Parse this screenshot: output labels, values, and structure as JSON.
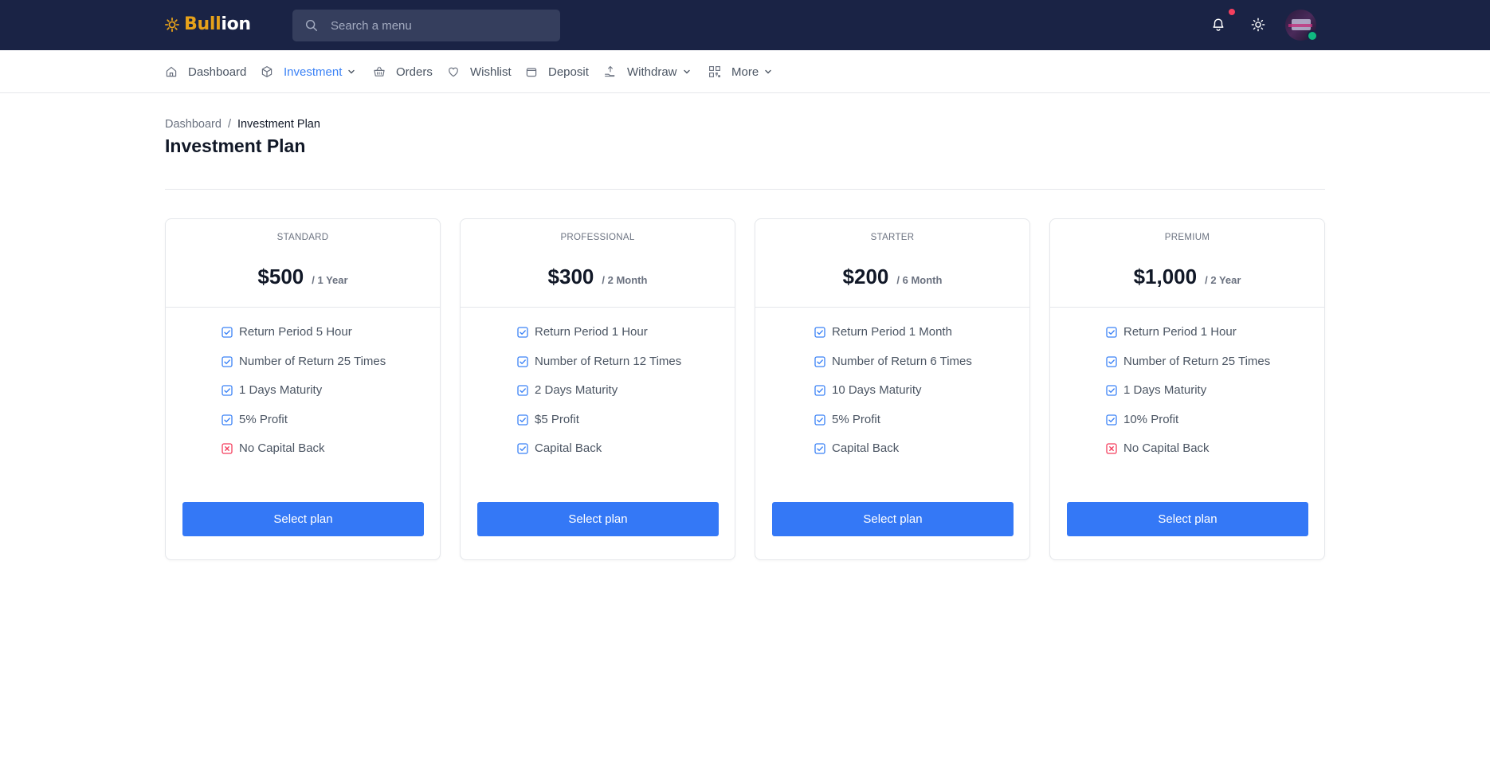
{
  "brand": {
    "part1": "Bull",
    "part2": "ion",
    "accent": "#e6a11a"
  },
  "search": {
    "placeholder": "Search a menu",
    "icon": "search-icon"
  },
  "topbar": {
    "bg": "#1a2345",
    "notification_icon": "bell-icon",
    "theme_icon": "sun-icon",
    "avatar": "user-avatar"
  },
  "nav": {
    "items": [
      {
        "label": "Dashboard",
        "icon": "home-icon"
      },
      {
        "label": "Investment",
        "icon": "cube-icon",
        "active": true,
        "dropdown": true
      },
      {
        "label": "Orders",
        "icon": "basket-icon"
      },
      {
        "label": "Wishlist",
        "icon": "heart-icon"
      },
      {
        "label": "Deposit",
        "icon": "wallet-icon"
      },
      {
        "label": "Withdraw",
        "icon": "withdraw-icon",
        "dropdown": true
      },
      {
        "label": "More",
        "icon": "qr-icon",
        "dropdown": true
      }
    ]
  },
  "breadcrumb": {
    "parent": "Dashboard",
    "separator": "/",
    "current": "Investment Plan"
  },
  "page": {
    "title": "Investment Plan"
  },
  "plans": [
    {
      "name": "STANDARD",
      "price": "$500",
      "period": "/ 1 Year",
      "features": [
        {
          "text": "Return Period 5 Hour",
          "ok": true
        },
        {
          "text": "Number of Return 25 Times",
          "ok": true
        },
        {
          "text": "1 Days Maturity",
          "ok": true
        },
        {
          "text": "5% Profit",
          "ok": true
        },
        {
          "text": "No Capital Back",
          "ok": false
        }
      ],
      "button": "Select plan"
    },
    {
      "name": "PROFESSIONAL",
      "price": "$300",
      "period": "/ 2 Month",
      "features": [
        {
          "text": "Return Period 1 Hour",
          "ok": true
        },
        {
          "text": "Number of Return 12 Times",
          "ok": true
        },
        {
          "text": "2 Days Maturity",
          "ok": true
        },
        {
          "text": "$5 Profit",
          "ok": true
        },
        {
          "text": "Capital Back",
          "ok": true
        }
      ],
      "button": "Select plan"
    },
    {
      "name": "STARTER",
      "price": "$200",
      "period": "/ 6 Month",
      "features": [
        {
          "text": "Return Period 1 Month",
          "ok": true
        },
        {
          "text": "Number of Return 6 Times",
          "ok": true
        },
        {
          "text": "10 Days Maturity",
          "ok": true
        },
        {
          "text": "5% Profit",
          "ok": true
        },
        {
          "text": "Capital Back",
          "ok": true
        }
      ],
      "button": "Select plan"
    },
    {
      "name": "PREMIUM",
      "price": "$1,000",
      "period": "/ 2 Year",
      "features": [
        {
          "text": "Return Period 1 Hour",
          "ok": true
        },
        {
          "text": "Number of Return 25 Times",
          "ok": true
        },
        {
          "text": "1 Days Maturity",
          "ok": true
        },
        {
          "text": "10% Profit",
          "ok": true
        },
        {
          "text": "No Capital Back",
          "ok": false
        }
      ],
      "button": "Select plan"
    }
  ],
  "colors": {
    "primary": "#3478f6",
    "check": "#3b82f6",
    "cross": "#f43f5e"
  }
}
